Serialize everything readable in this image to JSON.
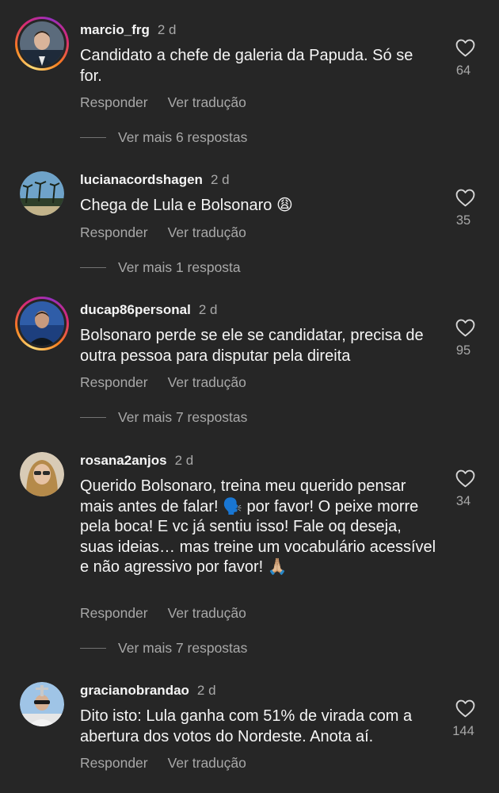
{
  "comments": [
    {
      "username": "marcio_frg",
      "time": "2 d",
      "text": "Candidato a chefe de galeria da Papuda. Só se for.",
      "likes": "64",
      "reply_label": "Responder",
      "translate_label": "Ver tradução",
      "more_replies": "Ver mais 6 respostas"
    },
    {
      "username": "lucianacordshagen",
      "time": "2 d",
      "text": "Chega de Lula e Bolsonaro 😩",
      "likes": "35",
      "reply_label": "Responder",
      "translate_label": "Ver tradução",
      "more_replies": "Ver mais 1 resposta"
    },
    {
      "username": "ducap86personal",
      "time": "2 d",
      "text": "Bolsonaro perde se ele se candidatar, precisa de outra pessoa para disputar pela direita",
      "likes": "95",
      "reply_label": "Responder",
      "translate_label": "Ver tradução",
      "more_replies": "Ver mais 7 respostas"
    },
    {
      "username": "rosana2anjos",
      "time": "2 d",
      "text": "Querido Bolsonaro, treina meu querido pensar mais antes de falar! 🗣️ por favor! O peixe morre pela boca! E vc já sentiu isso! Fale oq deseja, suas ideias… mas treine um vocabulário acessível e não agressivo por favor! 🙏🏼",
      "likes": "34",
      "reply_label": "Responder",
      "translate_label": "Ver tradução",
      "more_replies": "Ver mais 7 respostas"
    },
    {
      "username": "gracianobrandao",
      "time": "2 d",
      "text": "Dito isto: Lula ganha com 51% de virada com a abertura dos votos do Nordeste. Anota aí.",
      "likes": "144",
      "reply_label": "Responder",
      "translate_label": "Ver tradução",
      "more_replies": ""
    }
  ],
  "colors": {
    "background": "#262626",
    "primary_text": "#f5f5f5",
    "secondary_text": "#a8a8a8"
  },
  "icons": {
    "like": "heart-outline-icon",
    "story_ring": "story-ring-gradient"
  }
}
